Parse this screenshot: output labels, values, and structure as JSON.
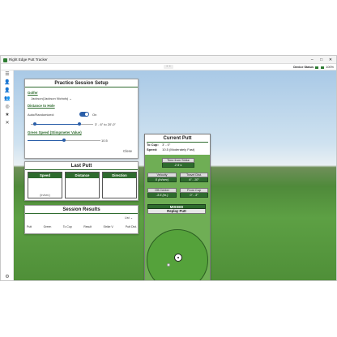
{
  "window": {
    "title": "Right Edge Putt Tracker",
    "min": "–",
    "max": "□",
    "close": "✕"
  },
  "toolbar": {
    "collapse": "⌃⌃",
    "device_status_label": "Device Status",
    "battery": "100%"
  },
  "sidebar": {
    "items": [
      {
        "icon": "menu-icon",
        "glyph": "☰"
      },
      {
        "icon": "person-icon",
        "glyph": "👤"
      },
      {
        "icon": "person-add-icon",
        "glyph": "👤"
      },
      {
        "icon": "people-icon",
        "glyph": "👥"
      },
      {
        "icon": "target-icon",
        "glyph": "◎"
      },
      {
        "icon": "star-icon",
        "glyph": "★"
      },
      {
        "icon": "close-icon",
        "glyph": "✕"
      }
    ],
    "bottom_glyph": "⚙"
  },
  "setup": {
    "title": "Practice Session Setup",
    "golfer_label": "Golfer",
    "golfer_value": "Jackson(Jackson Nichols)",
    "distance_label": "Distance to Hole",
    "auto_random_label": "Auto/Randomized:",
    "toggle_state": "On",
    "distance_range": "3' - 6\" to 20'-0\"",
    "green_speed_label": "Green Speed (Stimpmeter Value)",
    "green_speed_value": "10.5",
    "close_label": "Close"
  },
  "last_putt": {
    "title": "Last Putt",
    "speed_label": "Speed",
    "distance_label": "Distance",
    "direction_label": "Direction",
    "speed_unit": "(in/sec)"
  },
  "results": {
    "title": "Session Results",
    "list_label": "List",
    "columns": [
      "Putt",
      "Green",
      "To Cup",
      "Result",
      "Strike V.",
      "Putt Dist."
    ]
  },
  "current_putt": {
    "title": "Current Putt",
    "to_cup_label": "To Cup:",
    "to_cup_value": "3' - 0\"",
    "speed_label": "Speed:",
    "speed_value": "10.5 (Moderately Fast)",
    "time_label": "Time from Strike",
    "time_value": "2.9 s",
    "velocity_label": "Velocity",
    "velocity_value": "0 (in/sec)",
    "travel_label": "Travel Dist.",
    "travel_value": "6' - 10\"",
    "offcenter_label": "Off-Center",
    "offcenter_value": "-3.6 (in.)",
    "fromcup_label": "From Cup",
    "fromcup_value": "0' - 3\"",
    "result": "MISSED",
    "replay_label": "Replay Putt"
  },
  "colors": {
    "accent_green": "#2e6b2e",
    "toggle_blue": "#2a5ea8"
  }
}
